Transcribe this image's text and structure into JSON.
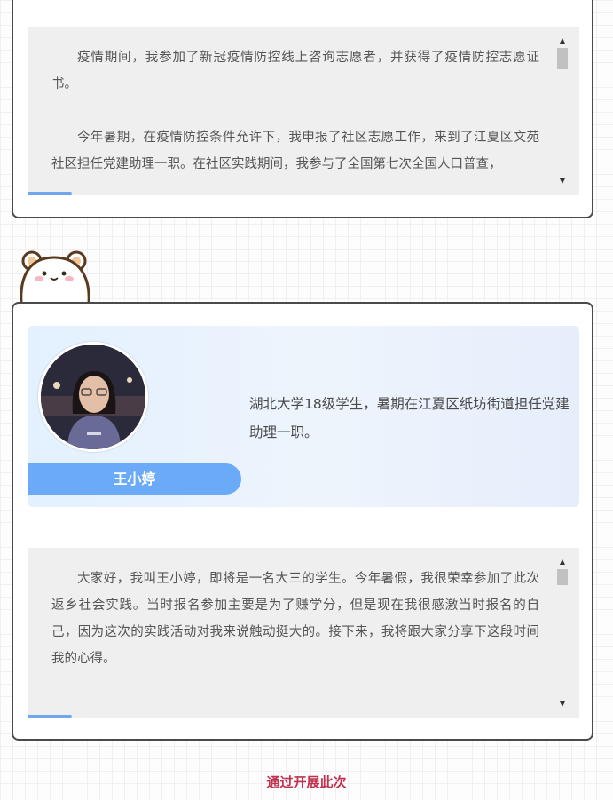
{
  "section1": {
    "paragraphs": [
      "疫情期间，我参加了新冠疫情防控线上咨询志愿者，并获得了疫情防控志愿证书。",
      "今年暑期，在疫情防控条件允许下，我申报了社区志愿工作，来到了江夏区文苑社区担任党建助理一职。在社区实践期间，我参与了全国第七次全国人口普查，"
    ]
  },
  "profile": {
    "name": "王小婷",
    "bio": "湖北大学18级学生，暑期在江夏区纸坊街道担任党建助理一职。"
  },
  "section2": {
    "paragraphs": [
      "大家好，我叫王小婷，即将是一名大三的学生。今年暑假，我很荣幸参加了此次返乡社会实践。当时报名参加主要是为了赚学分，但是现在我很感激当时报名的自己，因为这次的实践活动对我来说触动挺大的。接下来，我将跟大家分享下这段时间我的心得。"
    ]
  },
  "footer": {
    "text": "通过开展此次"
  },
  "icons": {
    "mascot": "bear-mascot-icon",
    "scroll_up": "scroll-up-arrow-icon",
    "scroll_down": "scroll-down-arrow-icon"
  },
  "colors": {
    "accent_blue": "#6aaaf7",
    "footer_red": "#c0324f",
    "card_border": "#4a4a4a",
    "textbox_bg": "#efefef"
  }
}
